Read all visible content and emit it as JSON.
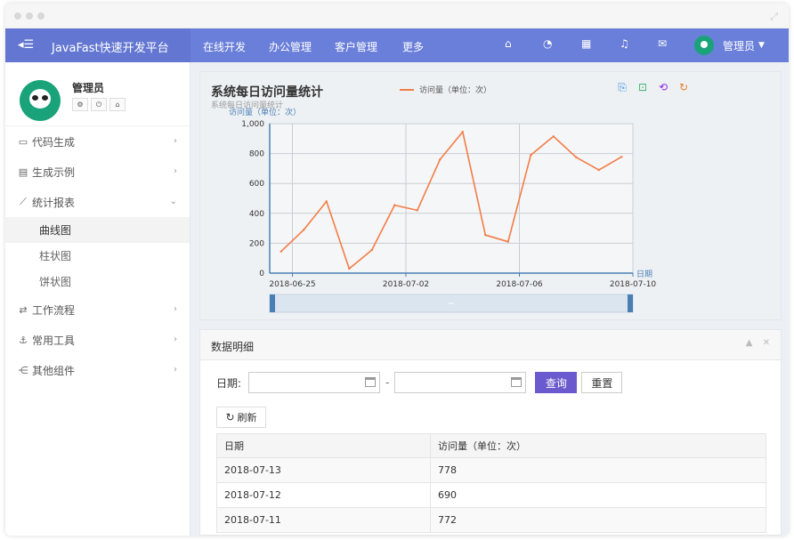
{
  "app": {
    "brand": "JavaFast快速开发平台"
  },
  "nav": {
    "items": [
      "在线开发",
      "办公管理",
      "客户管理",
      "更多"
    ],
    "user": "管理员"
  },
  "sidebar": {
    "username": "管理员",
    "menu": [
      {
        "label": "代码生成",
        "icon": "monitor-icon"
      },
      {
        "label": "生成示例",
        "icon": "file-icon"
      },
      {
        "label": "统计报表",
        "icon": "line-chart-icon"
      }
    ],
    "submenu": [
      "曲线图",
      "柱状图",
      "饼状图"
    ],
    "menu_after": [
      {
        "label": "工作流程",
        "icon": "exchange-icon"
      },
      {
        "label": "常用工具",
        "icon": "anchor-icon"
      },
      {
        "label": "其他组件",
        "icon": "share-icon"
      }
    ]
  },
  "chart_data": {
    "type": "line",
    "title": "系统每日访问量统计",
    "subtitle": "系统每日访问量统计",
    "ylabel": "访问量（单位：次）",
    "xlabel": "日期",
    "ylim": [
      0,
      1000
    ],
    "yticks": [
      "0",
      "200",
      "400",
      "600",
      "800",
      "1,000"
    ],
    "xtick_labels": [
      "2018-06-25",
      "2018-07-02",
      "2018-07-06",
      "2018-07-10"
    ],
    "xtick_positions": [
      1,
      6,
      11,
      16
    ],
    "legend_position": "top-center",
    "series": [
      {
        "name": "访问量（单位：次）",
        "color": "#f47c46",
        "values": [
          145,
          290,
          480,
          30,
          155,
          455,
          420,
          760,
          945,
          255,
          210,
          790,
          915,
          775,
          690,
          778
        ]
      }
    ]
  },
  "detail": {
    "title": "数据明细",
    "date_label": "日期:",
    "query_label": "查询",
    "reset_label": "重置",
    "refresh_label": "刷新",
    "columns": [
      "日期",
      "访问量（单位：次）"
    ],
    "rows": [
      [
        "2018-07-13",
        "778"
      ],
      [
        "2018-07-12",
        "690"
      ],
      [
        "2018-07-11",
        "772"
      ]
    ]
  },
  "colors": {
    "navbar": "#6a7fd9",
    "accent": "#6a5acd",
    "line": "#f47c46",
    "avatar": "#1aa37a"
  }
}
